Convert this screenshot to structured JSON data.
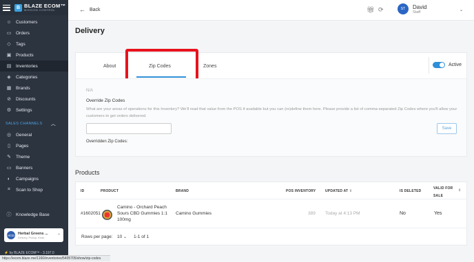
{
  "sidebar": {
    "brand": "BLAZE ECOM™",
    "brand_sub": "MISSION CONTROL",
    "items": [
      {
        "label": "Customers",
        "icon": "users-icon"
      },
      {
        "label": "Orders",
        "icon": "orders-icon"
      },
      {
        "label": "Tags",
        "icon": "tag-icon"
      },
      {
        "label": "Products",
        "icon": "box-icon"
      },
      {
        "label": "Inventories",
        "icon": "clipboard-icon"
      },
      {
        "label": "Categories",
        "icon": "categories-icon"
      },
      {
        "label": "Brands",
        "icon": "brand-icon"
      },
      {
        "label": "Discounts",
        "icon": "discount-icon"
      },
      {
        "label": "Settings",
        "icon": "gear-icon"
      }
    ],
    "section": "SALES CHANNELS",
    "channels": [
      {
        "label": "General",
        "icon": "globe-icon"
      },
      {
        "label": "Pages",
        "icon": "page-icon"
      },
      {
        "label": "Theme",
        "icon": "theme-icon"
      },
      {
        "label": "Banners",
        "icon": "banner-icon"
      },
      {
        "label": "Campaigns",
        "icon": "campaign-icon"
      },
      {
        "label": "Scan to Shop",
        "icon": "scan-icon"
      }
    ],
    "knowledge_base": "Knowledge Base",
    "store": {
      "avatar": "HGD",
      "name": "Herbal Greens ...",
      "sub": "Delivery, Pickup, Kiosk"
    },
    "version": "⚡ by BLAZE ECOM™ - 3.197.0",
    "url_tooltip": "https://ecom.blaze.me/1166/inventories/5405705/show/zip-codes",
    "accent": "#4da3e6"
  },
  "topbar": {
    "back_label": "Back",
    "user": {
      "initials": "ST",
      "name": "David",
      "role": "Staff"
    }
  },
  "page_title": "Delivery",
  "tabs": [
    {
      "label": "About"
    },
    {
      "label": "Zip Codes"
    },
    {
      "label": "Zones"
    }
  ],
  "toggle": {
    "label": "Active",
    "on": true
  },
  "zip": {
    "na": "N/A",
    "title": "Override Zip Codes",
    "description": "What are your areas of operations for this Inventory? We'll read that value from the POS if available but you can (re)define them here. Please provide a list of comma-separated Zip Codes where you'll allow your customers to get orders delivered.",
    "input_value": "",
    "save_label": "Save",
    "overridden_label": "Overridden Zip Codes:"
  },
  "products": {
    "title": "Products",
    "columns": [
      "ID",
      "PRODUCT",
      "BRAND",
      "POS INVENTORY",
      "UPDATED AT",
      "IS DELETED",
      "VALID FOR SALE"
    ],
    "rows": [
      {
        "id": "#1602051",
        "product_line1": "Camino - Orchard Peach",
        "product_line2": "Sours CBD Gummies 1:1",
        "product_line3": "100mg",
        "brand": "Camino Gummies",
        "pos_inventory": "389",
        "updated_at": "Today at 4:13 PM",
        "is_deleted": "No",
        "valid_for_sale": "Yes"
      }
    ],
    "rows_per_page_label": "Rows per page:",
    "rows_per_page": "10",
    "range": "1-1 of 1"
  },
  "highlight_color": "#e8121c"
}
